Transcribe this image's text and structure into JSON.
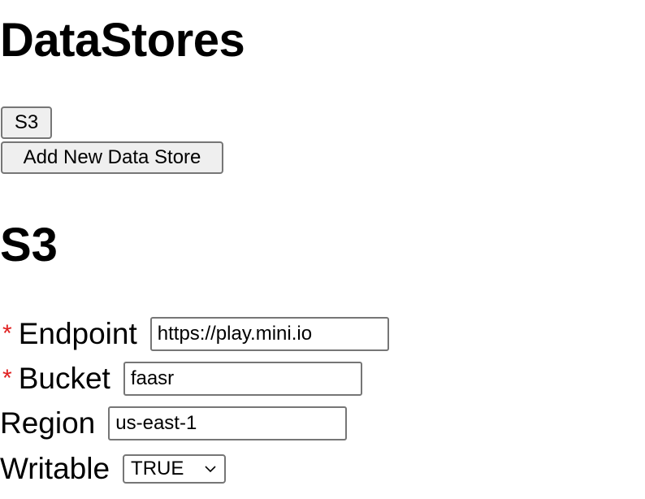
{
  "page": {
    "title": "DataStores"
  },
  "datastores": {
    "list": [
      {
        "label": "S3"
      }
    ],
    "add_button_label": "Add New Data Store"
  },
  "form": {
    "section_title": "S3",
    "required_marker": "*",
    "endpoint": {
      "label": "Endpoint",
      "value": "https://play.mini.io",
      "required": true
    },
    "bucket": {
      "label": "Bucket",
      "value": "faasr",
      "required": true
    },
    "region": {
      "label": "Region",
      "value": "us-east-1",
      "required": false
    },
    "writable": {
      "label": "Writable",
      "selected": "TRUE",
      "icon": "chevron-down-icon"
    }
  },
  "colors": {
    "required_marker": "#e02020",
    "button_bg": "#efefef",
    "border": "#767676"
  }
}
